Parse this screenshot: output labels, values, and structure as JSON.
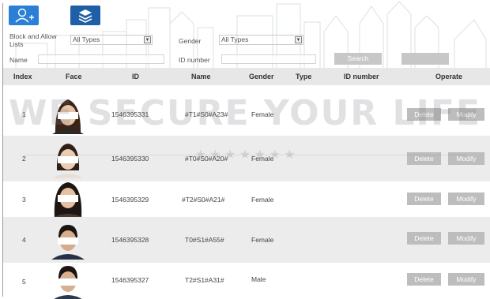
{
  "toolbar": {
    "add_icon": "add-user-icon",
    "library_icon": "library-icon"
  },
  "filters": {
    "list_label": "Block and Allow Lists",
    "list_value": "All Types",
    "gender_label": "Gender",
    "gender_value": "All Types",
    "name_label": "Name",
    "name_value": "",
    "id_label": "ID number",
    "id_value": "",
    "search_label": "Search"
  },
  "watermark": {
    "text": "WE SECURE YOUR LIFE"
  },
  "table": {
    "headers": [
      "Index",
      "Face",
      "ID",
      "Name",
      "Gender",
      "Type",
      "ID number",
      "Operate"
    ],
    "rows": [
      {
        "index": "1",
        "id": "1546395331",
        "name": "#T1#S0#A23#",
        "gender": "Female",
        "delete": "Delete",
        "modify": "Modify"
      },
      {
        "index": "2",
        "id": "1546395330",
        "name": "#T0#S0#A20#",
        "gender": "Female",
        "delete": "Delete",
        "modify": "Modify"
      },
      {
        "index": "3",
        "id": "1546395329",
        "name": "#T2#S0#A21#",
        "gender": "Female",
        "delete": "Delete",
        "modify": "Modify"
      },
      {
        "index": "4",
        "id": "1546395328",
        "name": "T0#S1#A55#",
        "gender": "Female",
        "delete": "Delete",
        "modify": "Modify"
      },
      {
        "index": "5",
        "id": "1546395327",
        "name": "T2#S1#A31#",
        "gender": "Male",
        "delete": "Delete",
        "modify": "Modify"
      }
    ]
  }
}
